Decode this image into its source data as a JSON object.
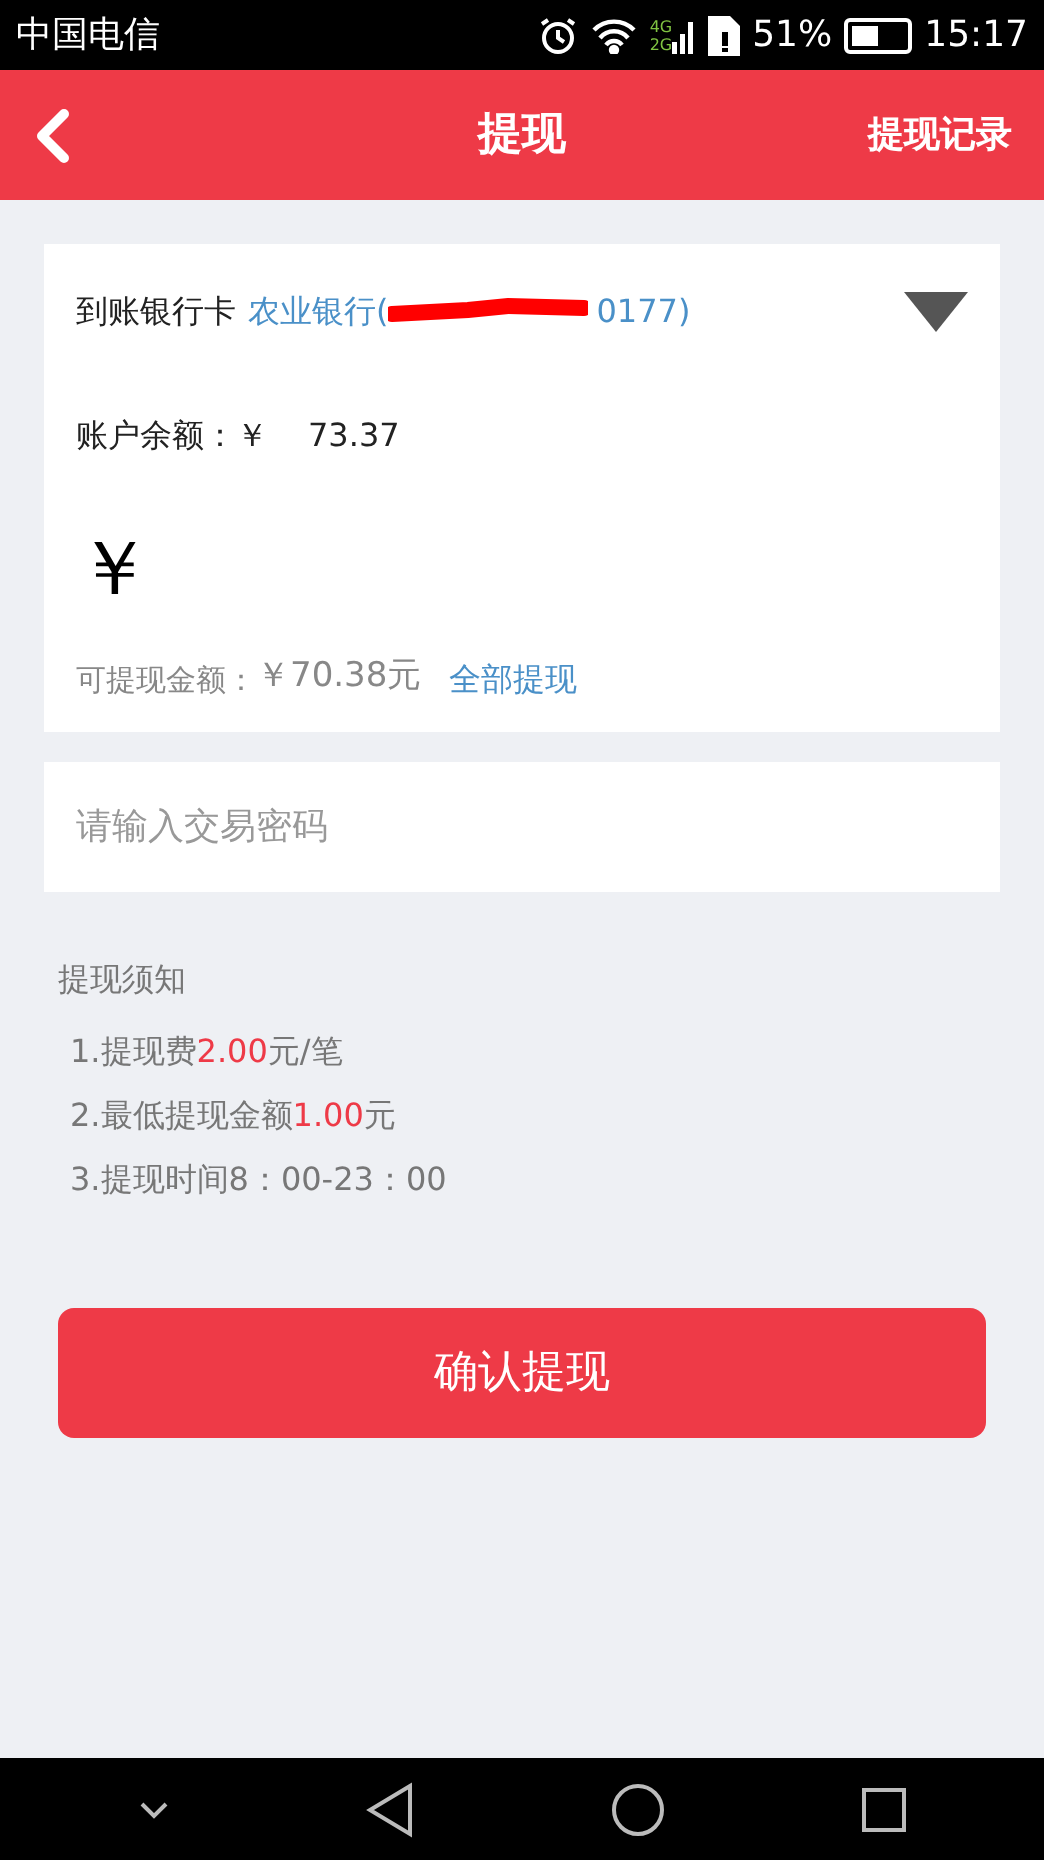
{
  "status_bar": {
    "carrier": "中国电信",
    "network_top": "4G",
    "network_bottom": "2G",
    "battery": "51%",
    "time": "15:17"
  },
  "header": {
    "title": "提现",
    "action": "提现记录"
  },
  "card": {
    "bank_label": "到账银行卡",
    "bank_name": "农业银行(",
    "bank_tail": "0177)",
    "redacted": true,
    "balance_label": "账户余额：￥",
    "balance": "73.37",
    "currency": "￥",
    "available_label": "可提现金额：",
    "available": "￥70.38元",
    "withdraw_all": "全部提现"
  },
  "password": {
    "placeholder": "请输入交易密码"
  },
  "notice": {
    "title": "提现须知",
    "items": [
      [
        {
          "text": "1.提现费",
          "highlight": false
        },
        {
          "text": "2.00",
          "highlight": true
        },
        {
          "text": "元/笔",
          "highlight": false
        }
      ],
      [
        {
          "text": "2.最低提现金额",
          "highlight": false
        },
        {
          "text": "1.00",
          "highlight": true
        },
        {
          "text": "元",
          "highlight": false
        }
      ],
      [
        {
          "text": "3.提现时间8：00-23：00",
          "highlight": false
        }
      ]
    ]
  },
  "confirm_button": "确认提现"
}
